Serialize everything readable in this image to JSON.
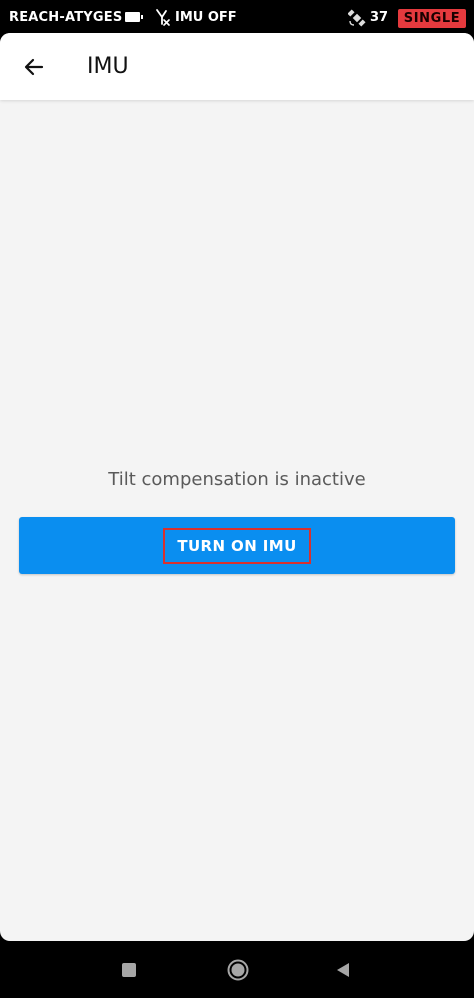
{
  "status_bar": {
    "device_name": "REACH-ATYGES",
    "battery_icon": "battery-icon",
    "imu_icon": "imu-off-icon",
    "imu_status": "IMU OFF",
    "satellite_icon": "satellite-icon",
    "satellite_count": "37",
    "solution_status": "SINGLE",
    "solution_color": "#e53a3e"
  },
  "app_bar": {
    "back_icon": "arrow-left-icon",
    "title": "IMU"
  },
  "content": {
    "message": "Tilt compensation is inactive",
    "button_label": "TURN ON IMU",
    "button_color": "#0a8ef0",
    "highlight_color": "#d8312f"
  },
  "nav_bar": {
    "recents_icon": "square-icon",
    "home_icon": "circle-icon",
    "back_icon": "triangle-back-icon"
  }
}
